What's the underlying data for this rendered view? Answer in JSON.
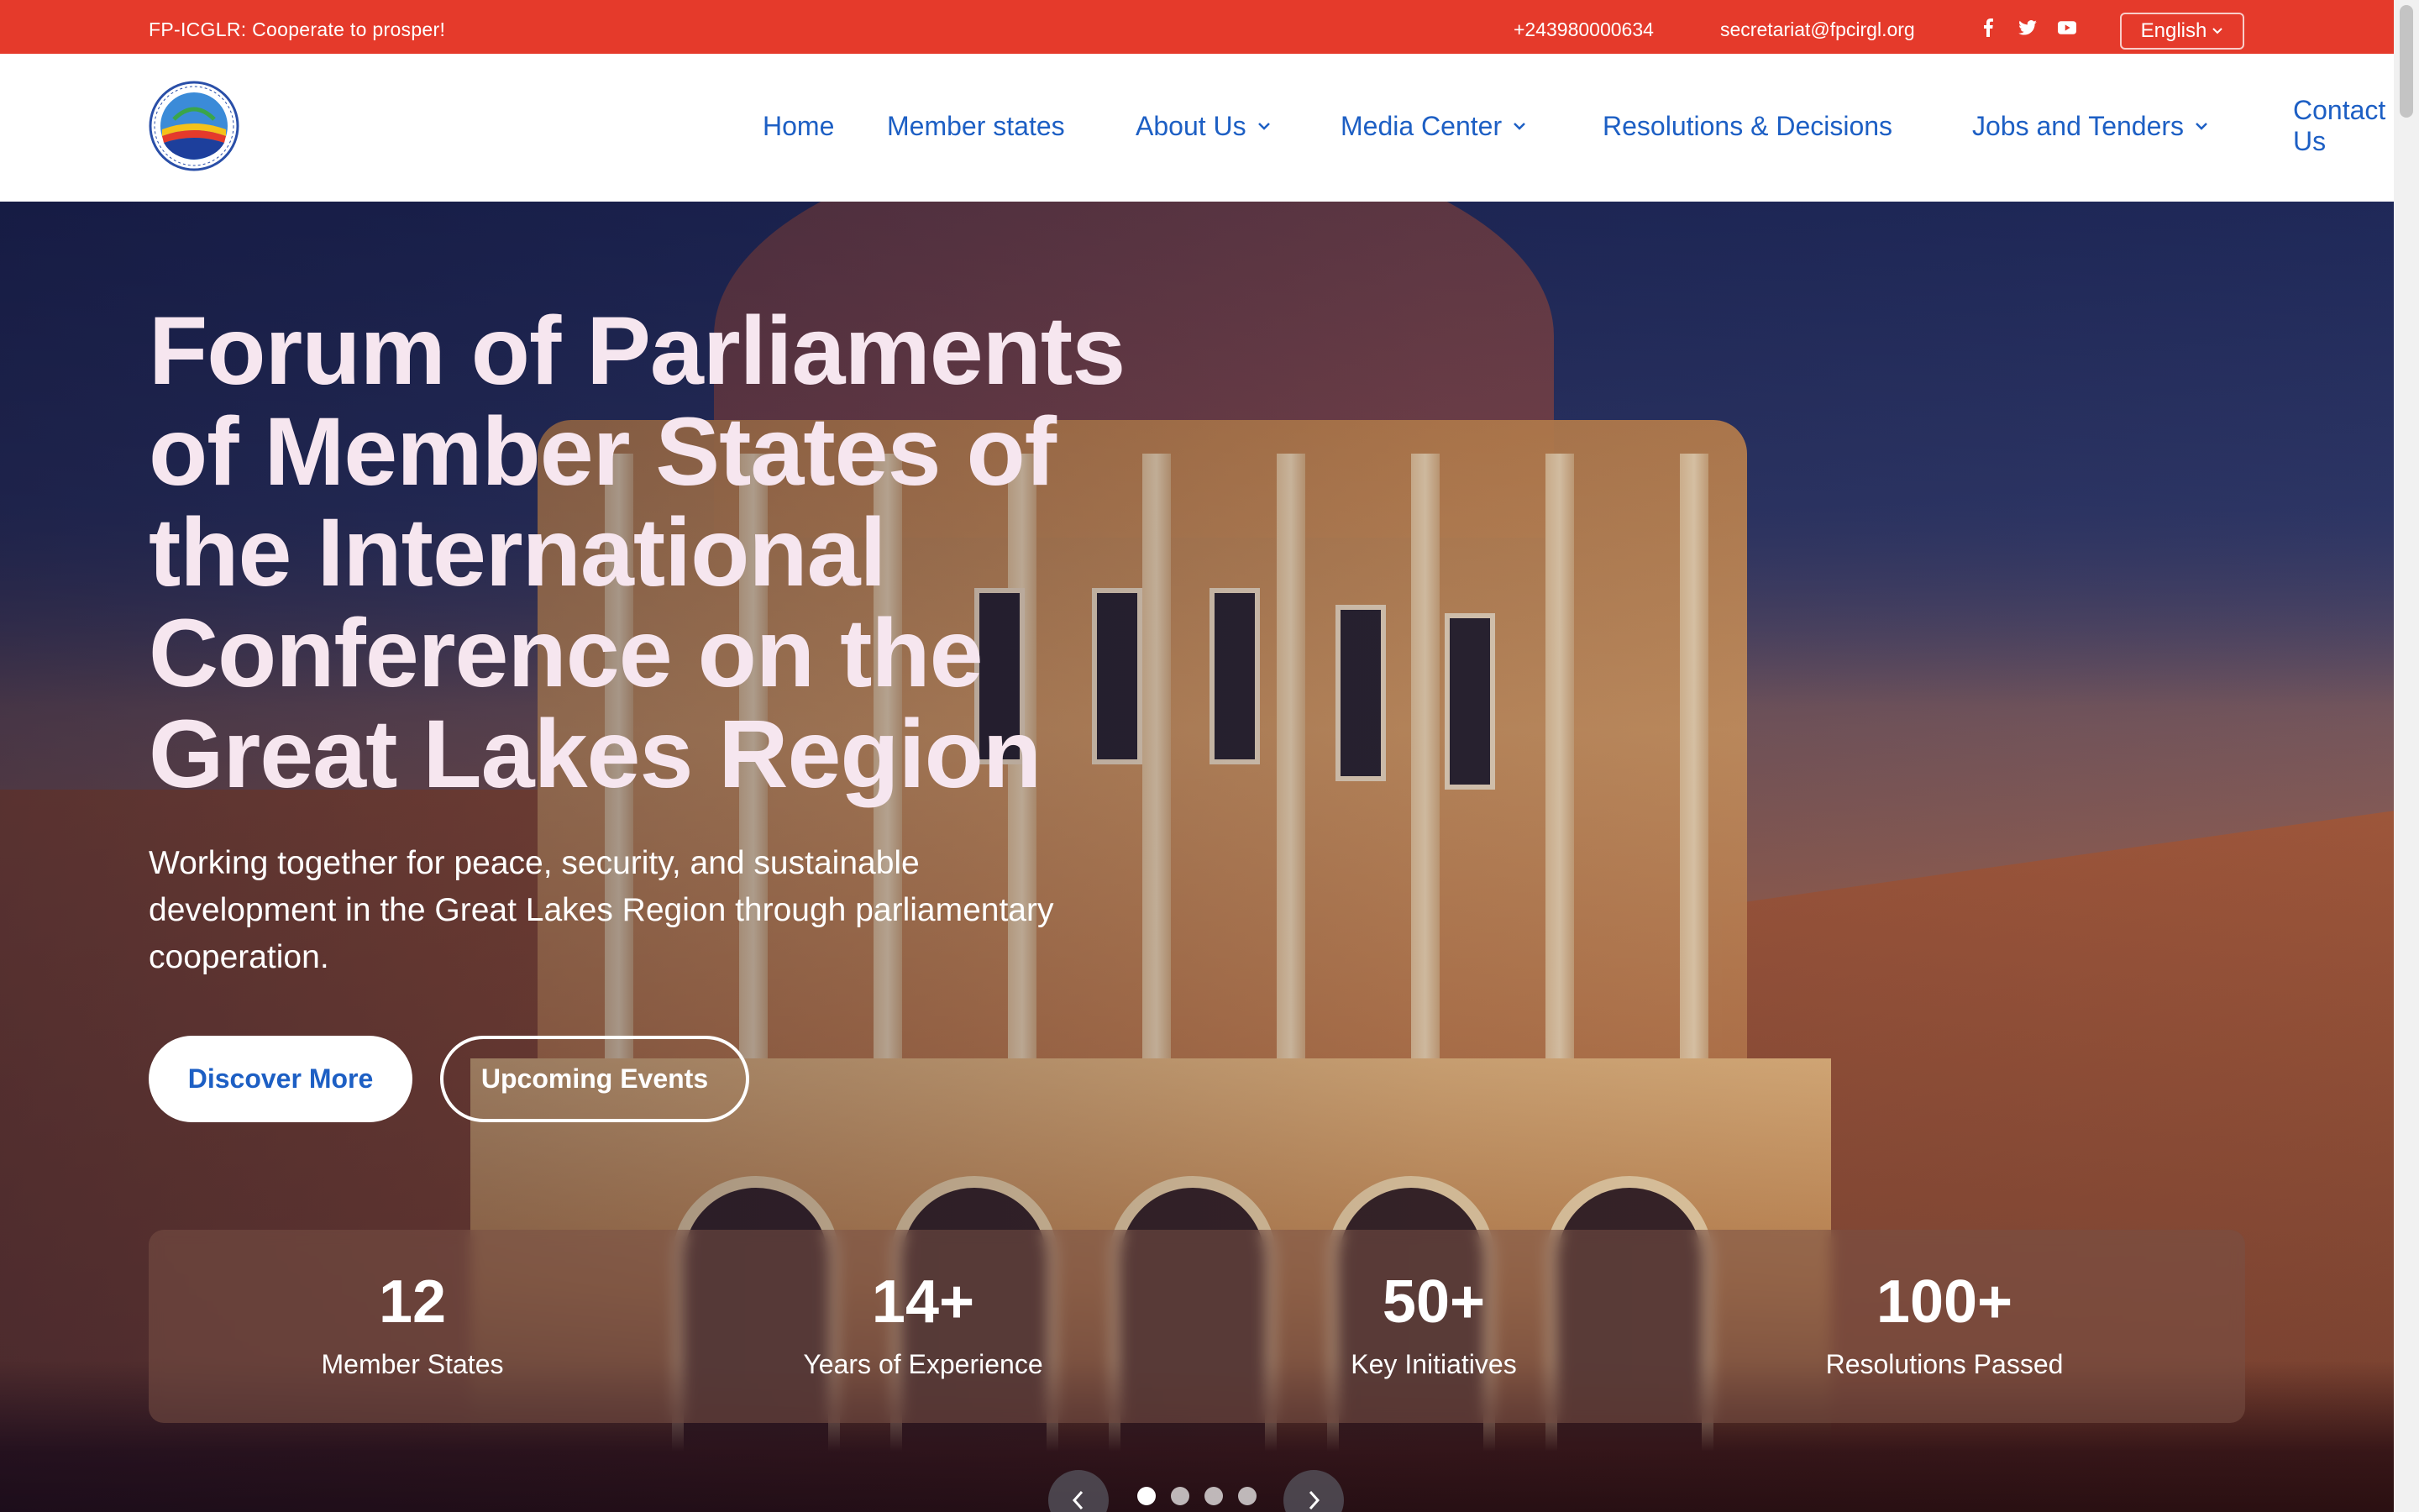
{
  "topbar": {
    "tagline": "FP-ICGLR: Cooperate to prosper!",
    "phone": "+243980000634",
    "email": "secretariat@fpcirgl.org",
    "social": [
      "facebook-icon",
      "twitter-icon",
      "youtube-icon"
    ],
    "language": "English",
    "bg_color": "#e53a2b"
  },
  "header": {
    "logo_icon": "parliament-logo",
    "nav": [
      {
        "label": "Home",
        "dropdown": false
      },
      {
        "label": "Member states",
        "dropdown": false
      },
      {
        "label": "About Us",
        "dropdown": true
      },
      {
        "label": "Media Center",
        "dropdown": true
      },
      {
        "label": "Resolutions & Decisions",
        "dropdown": false
      },
      {
        "label": "Jobs and Tenders",
        "dropdown": true
      },
      {
        "label": "Contact Us",
        "dropdown": false
      }
    ],
    "nav_color": "#1d5fc4"
  },
  "hero": {
    "title_lines": [
      "Forum of Parliaments",
      "of Member States of",
      "the International",
      "Conference on the",
      "Great Lakes Region"
    ],
    "subtitle": "Working together for peace, security, and sustainable development in the Great Lakes Region through parliamentary cooperation.",
    "buttons": {
      "primary": "Discover More",
      "secondary": "Upcoming Events"
    },
    "stats": [
      {
        "value": "12",
        "label": "Member States"
      },
      {
        "value": "14+",
        "label": "Years of Experience"
      },
      {
        "value": "50+",
        "label": "Key Initiatives"
      },
      {
        "value": "100+",
        "label": "Resolutions Passed"
      }
    ],
    "carousel": {
      "slides": 4,
      "active": 1,
      "prev_icon": "chevron-left-icon",
      "next_icon": "chevron-right-icon"
    }
  }
}
